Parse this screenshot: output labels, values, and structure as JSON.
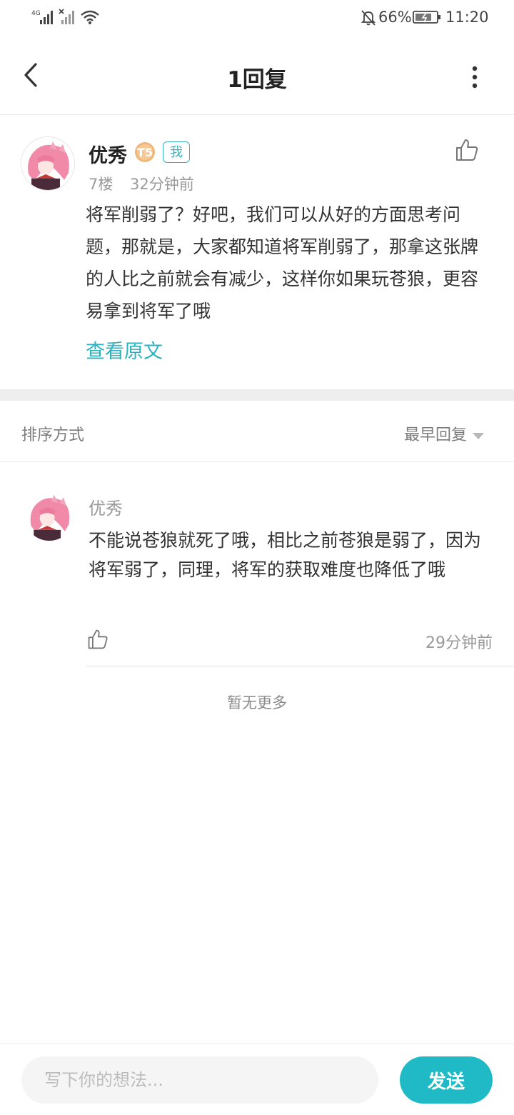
{
  "status_bar": {
    "network_1": "4G",
    "battery": "66%",
    "time": "11:20",
    "icons": [
      "signal-icon",
      "no-signal-icon",
      "wifi-icon",
      "mute-bell-icon",
      "battery-charging-icon"
    ]
  },
  "header": {
    "title": "1回复",
    "back_icon": "chevron-left-icon",
    "more_icon": "more-vertical-icon"
  },
  "post": {
    "username": "优秀",
    "level_badge": "T5",
    "me_badge": "我",
    "floor": "7楼",
    "time": "32分钟前",
    "content": "将军削弱了？好吧，我们可以从好的方面思考问题，那就是，大家都知道将军削弱了，那拿这张牌的人比之前就会有减少，这样你如果玩苍狼，更容易拿到将军了哦",
    "view_original": "查看原文"
  },
  "sort": {
    "label": "排序方式",
    "selected": "最早回复"
  },
  "replies": [
    {
      "username": "优秀",
      "content": "不能说苍狼就死了哦，相比之前苍狼是弱了，因为将军弱了，同理，将军的获取难度也降低了哦",
      "time": "29分钟前"
    }
  ],
  "no_more": "暂无更多",
  "composer": {
    "placeholder": "写下你的想法...",
    "send_label": "发送"
  },
  "colors": {
    "accent": "#1fbac6",
    "link": "#2bb3c0",
    "badge_gold": "#f0b77a"
  }
}
